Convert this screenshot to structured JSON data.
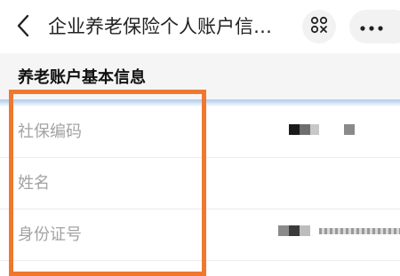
{
  "header": {
    "title": "企业养老保险个人账户信…",
    "back_icon": "chevron-left-icon",
    "scan_icon": "scan-icon",
    "more_icon": "more-dots-icon"
  },
  "section": {
    "title": "养老账户基本信息"
  },
  "rows": [
    {
      "label": "社保编码"
    },
    {
      "label": "姓名"
    },
    {
      "label": "身份证号"
    }
  ],
  "colors": {
    "accent_highlight": "#f0782e",
    "label_gray": "#a3a3a3"
  }
}
